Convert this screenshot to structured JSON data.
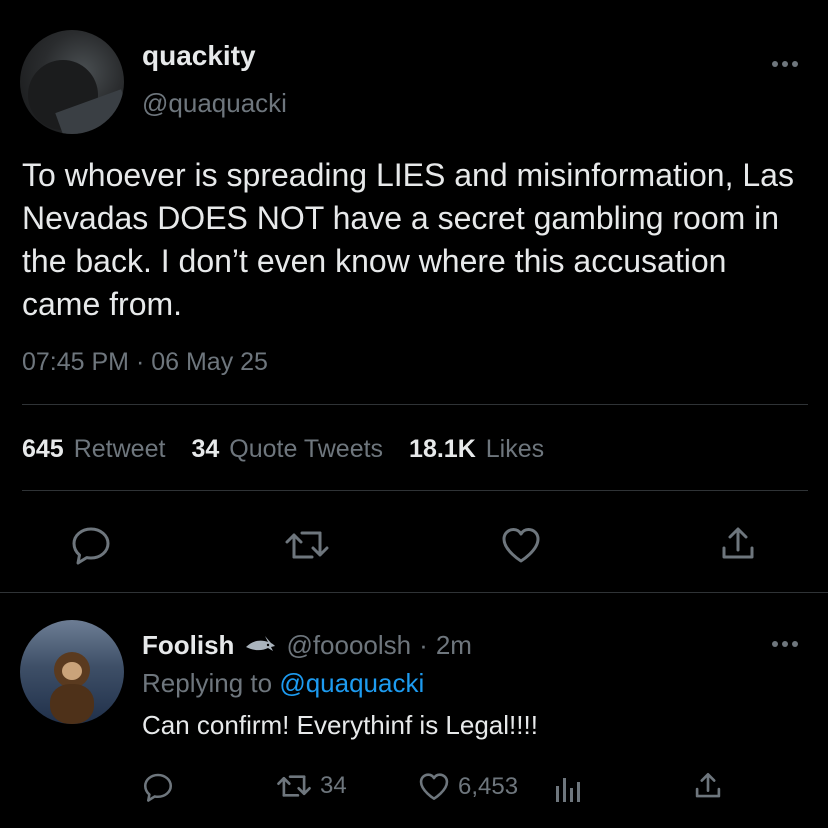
{
  "tweet": {
    "display_name": "quackity",
    "handle": "@quaquacki",
    "text": "To whoever is spreading LIES and misinformation, Las Nevadas DOES NOT have a secret gambling room in the back. I don’t even know where this accusation came from.",
    "timestamp": "07:45 PM · 06 May 25",
    "more_icon": "more-horizontal-icon",
    "stats": {
      "retweets_count": "645",
      "retweets_label": "Retweet",
      "quotes_count": "34",
      "quotes_label": "Quote Tweets",
      "likes_count": "18.1K",
      "likes_label": "Likes"
    },
    "actions": [
      "reply-icon",
      "retweet-icon",
      "like-icon",
      "share-icon"
    ]
  },
  "reply": {
    "display_name": "Foolish",
    "badge_icon": "shark-icon",
    "handle": "@foooolsh",
    "time_sep": "·",
    "time": "2m",
    "replying_prefix": "Replying to",
    "replying_handle": "@quaquacki",
    "text": "Can confirm! Everythinf is Legal!!!!",
    "retweets": "34",
    "likes": "6,453",
    "actions": [
      "reply-icon",
      "retweet-icon",
      "like-icon",
      "analytics-icon",
      "share-icon"
    ]
  },
  "colors": {
    "background": "#000000",
    "text": "#e7e9ea",
    "muted": "#6e767d",
    "link": "#1d9bf0",
    "divider": "#2f3336"
  }
}
